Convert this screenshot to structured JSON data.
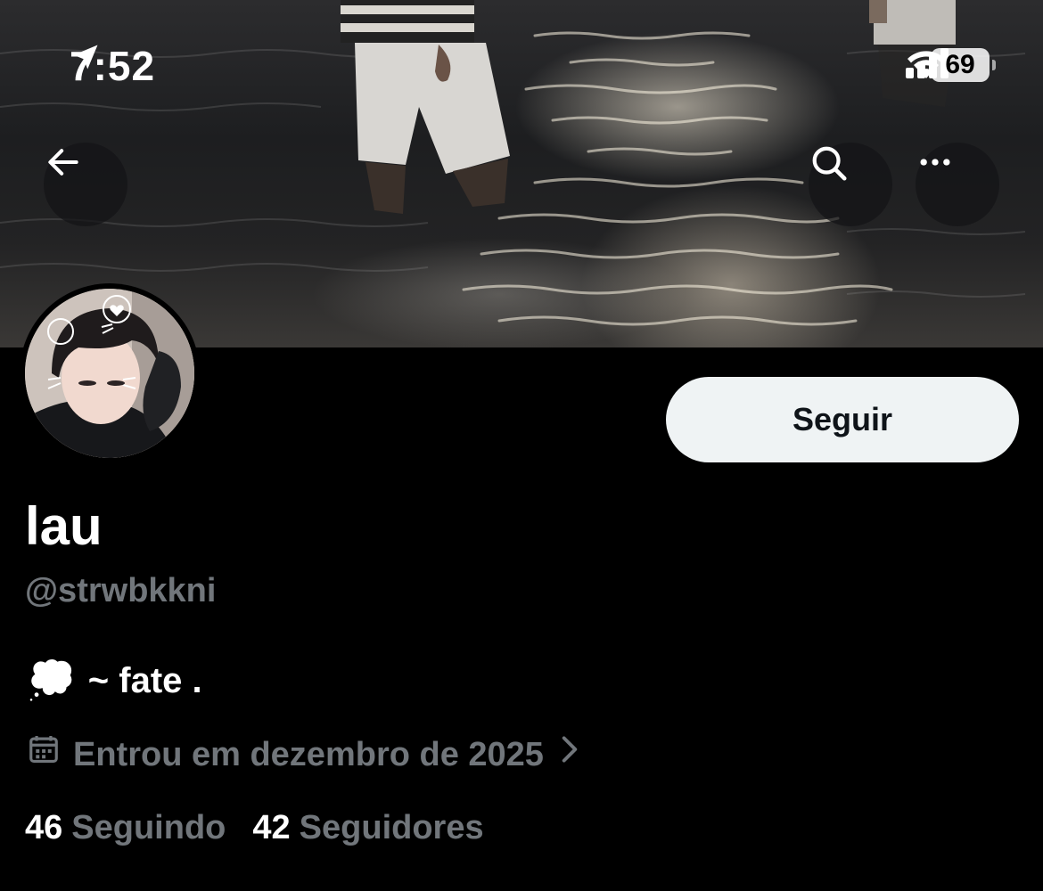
{
  "status_bar": {
    "time": "7:52",
    "battery": "69",
    "icons": [
      "location-arrow-icon",
      "cellular-signal-icon",
      "wifi-icon",
      "battery-icon"
    ]
  },
  "nav": {
    "back_icon": "arrow-left-icon",
    "search_icon": "search-icon",
    "more_icon": "more-horizontal-icon"
  },
  "profile": {
    "display_name": "lau",
    "handle": "@strwbkkni",
    "bio_emoji": "💭",
    "bio_text": "~ fate .",
    "joined": "Entrou em dezembro de 2025",
    "joined_icon": "calendar-icon"
  },
  "actions": {
    "follow_label": "Seguir"
  },
  "stats": [
    {
      "count": "46",
      "label": "Seguindo"
    },
    {
      "count": "42",
      "label": "Seguidores"
    }
  ],
  "colors": {
    "background": "#000000",
    "text_primary": "#ffffff",
    "text_secondary": "#71767b",
    "follow_button_bg": "#eff3f4",
    "follow_button_text": "#0f1419"
  }
}
